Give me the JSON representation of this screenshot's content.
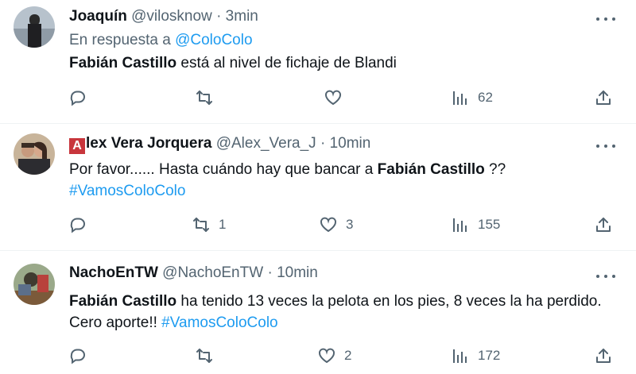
{
  "tweets": [
    {
      "name": "Joaquín",
      "handle": "@vilosknow",
      "separator": "·",
      "time": "3min",
      "reply_prefix": "En respuesta a ",
      "reply_mention": "@ColoColo",
      "text_bold": "Fabián Castillo",
      "text_rest": " está al nivel de fichaje de Blandi",
      "views": "62",
      "colors": {
        "name": "#0f1419",
        "secondary": "#536471",
        "link": "#1d9bf0"
      }
    },
    {
      "name_badge": "A",
      "name": "lex Vera Jorquera",
      "handle": "@Alex_Vera_J",
      "separator": "·",
      "time": "10min",
      "text_pre": "Por favor...... Hasta cuándo hay que bancar a ",
      "text_bold": "Fabián Castillo",
      "text_post": " ??",
      "hashtag": "#VamosColoColo",
      "retweets": "1",
      "likes": "3",
      "views": "155",
      "badge_color": "#c8363c"
    },
    {
      "name": "NachoEnTW",
      "handle": "@NachoEnTW",
      "separator": "·",
      "time": "10min",
      "text_bold": "Fabián Castillo",
      "text_rest": " ha tenido 13 veces la pelota en los pies, 8 veces la ha perdido. Cero aporte!! ",
      "hashtag": "#VamosColoColo",
      "likes": "2",
      "views": "172"
    }
  ],
  "icons": [
    "reply-icon",
    "retweet-icon",
    "like-icon",
    "views-icon",
    "share-icon",
    "more-icon"
  ]
}
